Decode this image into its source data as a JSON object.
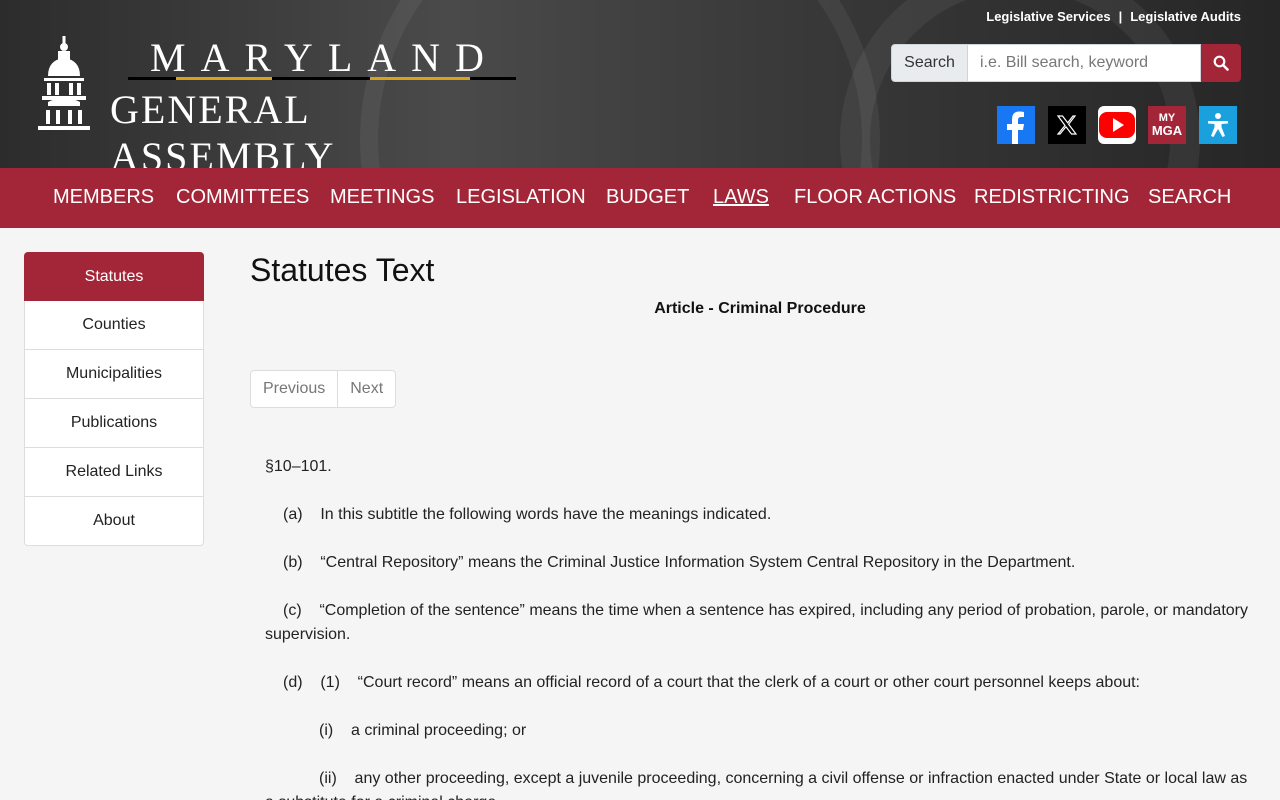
{
  "header": {
    "top_links": [
      "Legislative Services",
      "Legislative Audits"
    ],
    "top_sep": "|",
    "logo_line1": "MARYLAND",
    "logo_line2": "GENERAL ASSEMBLY",
    "search_label": "Search",
    "search_placeholder": "i.e. Bill search, keyword",
    "social": [
      "facebook-icon",
      "x-twitter-icon",
      "youtube-icon",
      "mymga-icon",
      "accessibility-icon"
    ],
    "mymga_text_top": "MY",
    "mymga_text_bottom": "MGA"
  },
  "nav": {
    "items": [
      "MEMBERS",
      "COMMITTEES",
      "MEETINGS",
      "LEGISLATION",
      "BUDGET",
      "LAWS",
      "FLOOR ACTIONS",
      "REDISTRICTING",
      "SEARCH"
    ],
    "active": "LAWS"
  },
  "sidebar": {
    "items": [
      "Statutes",
      "Counties",
      "Municipalities",
      "Publications",
      "Related Links",
      "About"
    ],
    "active": "Statutes"
  },
  "main": {
    "title": "Statutes Text",
    "article": "Article - Criminal Procedure",
    "prev_label": "Previous",
    "next_label": "Next",
    "statute": {
      "section": "§10–101.",
      "a": "(a)    In this subtitle the following words have the meanings indicated.",
      "b": "(b)    “Central Repository” means the Criminal Justice Information System Central Repository in the Department.",
      "c": "(c)    “Completion of the sentence” means the time when a sentence has expired, including any period of probation, parole, or mandatory supervision.",
      "d1": "(d)    (1)    “Court record” means an official record of a court that the clerk of a court or other court personnel keeps about:",
      "di": "(i)    a criminal proceeding; or",
      "dii": "(ii)    any other proceeding, except a juvenile proceeding, concerning a civil offense or infraction enacted under State or local law as a substitute for a criminal charge."
    }
  },
  "colors": {
    "brand": "#a32638",
    "gold": "#d9a21b",
    "facebook": "#1877f2",
    "youtube": "#ff0000",
    "accessibility": "#1aa0dc"
  }
}
